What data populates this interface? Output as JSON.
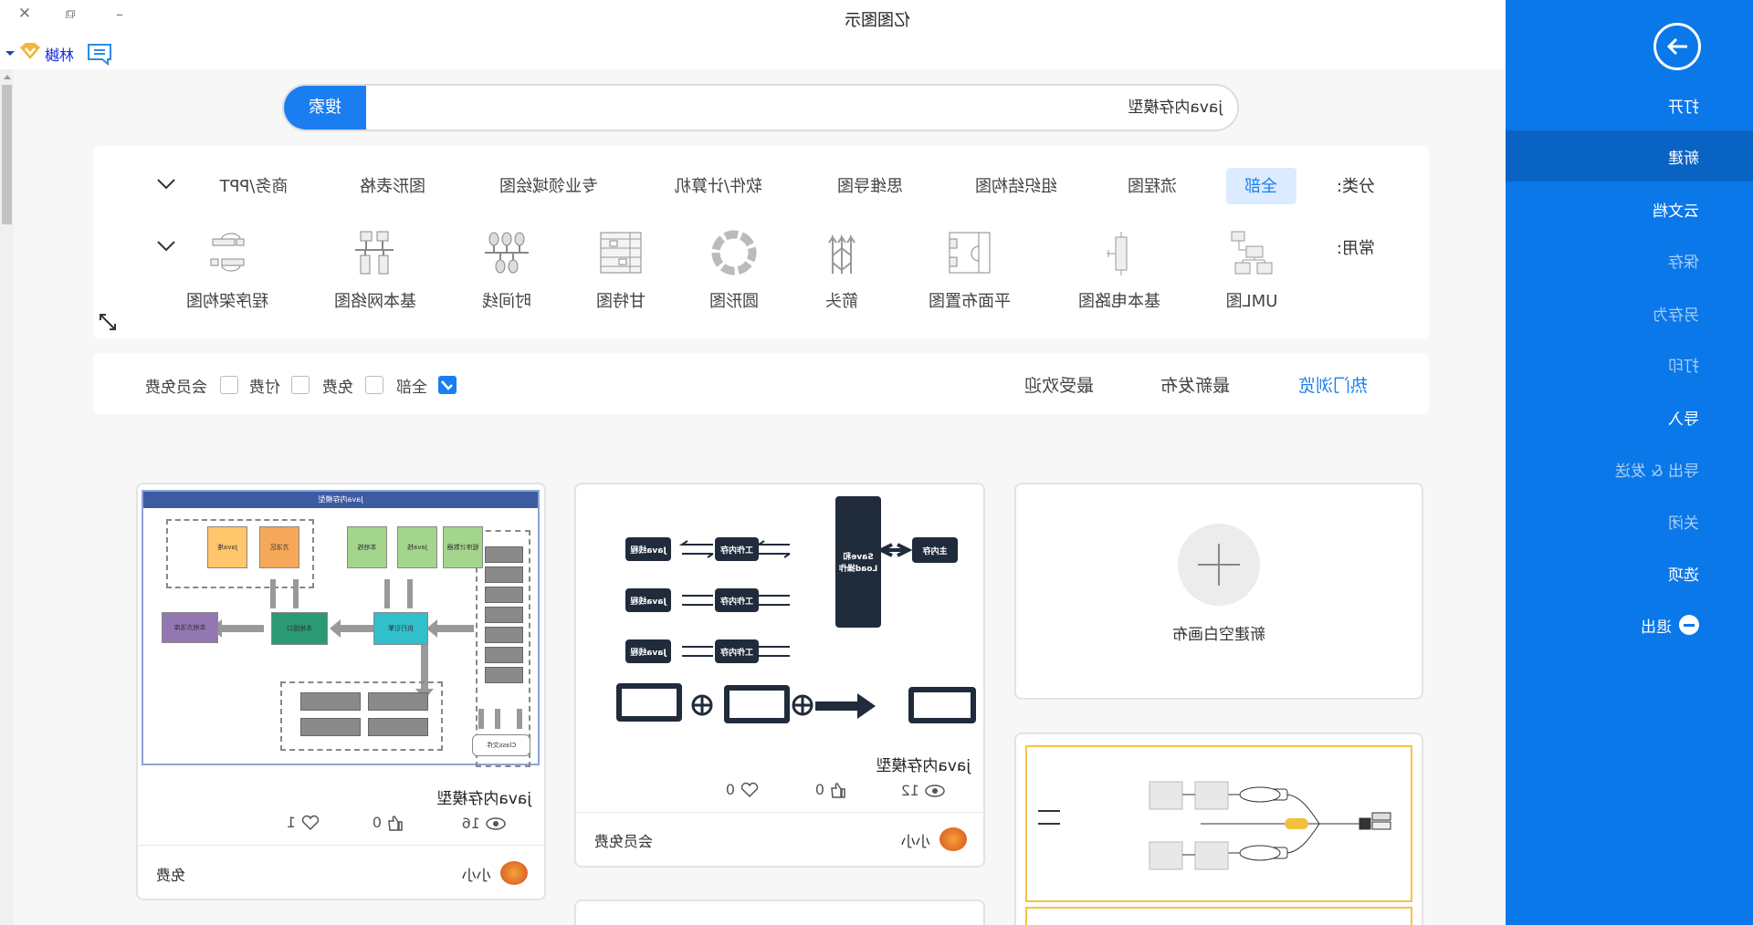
{
  "app": {
    "title": "亿图图示",
    "user": "樾林"
  },
  "window": {
    "minimize": "–",
    "restore": "⧉",
    "close": "✕"
  },
  "sidebar": {
    "items": [
      {
        "label": "打开",
        "state": "normal"
      },
      {
        "label": "新建",
        "state": "active"
      },
      {
        "label": "云文档",
        "state": "normal"
      },
      {
        "label": "保存",
        "state": "dim"
      },
      {
        "label": "另存为",
        "state": "dim"
      },
      {
        "label": "打印",
        "state": "dim"
      },
      {
        "label": "导入",
        "state": "normal"
      },
      {
        "label": "导出 & 发送",
        "state": "dim"
      },
      {
        "label": "关闭",
        "state": "dim"
      },
      {
        "label": "选项",
        "state": "normal"
      },
      {
        "label": "退出",
        "state": "normal"
      }
    ]
  },
  "search": {
    "button": "搜索",
    "value": "java内存模型"
  },
  "categories": {
    "label": "分类:",
    "items": [
      "全部",
      "流程图",
      "组织结构图",
      "思维导图",
      "软件/计算机",
      "专业领域绘图",
      "图形表格",
      "商务/PPT"
    ],
    "selected": "全部"
  },
  "common": {
    "label": "常用:",
    "items": [
      "UML图",
      "基本电路图",
      "平面布置图",
      "箭头",
      "圆形图",
      "甘特图",
      "时间线",
      "基本网络图",
      "程序架构图"
    ]
  },
  "sort": {
    "tabs": [
      "热门浏览",
      "最新发布",
      "最受欢迎"
    ],
    "active": "热门浏览"
  },
  "filters": [
    {
      "label": "全部",
      "checked": true
    },
    {
      "label": "免费",
      "checked": false
    },
    {
      "label": "付费",
      "checked": false
    },
    {
      "label": "会员免费",
      "checked": false
    }
  ],
  "blank": {
    "label": "新建空白画布"
  },
  "cards": [
    {
      "title": "java内存模型",
      "views": "12",
      "likes": "0",
      "favorites": "0",
      "author": "小小",
      "price": "会员免费",
      "thumb": {
        "thread": "Java线程",
        "work": "工作内存",
        "saveload": "Save和Load操作",
        "main": "主内存"
      }
    },
    {
      "title": "java内存模型",
      "views": "16",
      "likes": "0",
      "favorites": "1",
      "author": "小小",
      "price": "免费",
      "thumb": {
        "header": "Java内存模型",
        "boxes": [
          "方法区",
          "Java堆",
          "Java栈",
          "本地栈",
          "程序计数器"
        ],
        "engine": "执行引擎",
        "native": "本地接口",
        "lib": "本地方法库",
        "file": "Class文件"
      }
    }
  ],
  "colors": {
    "accent": "#0b78e9",
    "active": "#0963c2",
    "search": "#1a7ef0",
    "highlight": "#dcebff"
  }
}
